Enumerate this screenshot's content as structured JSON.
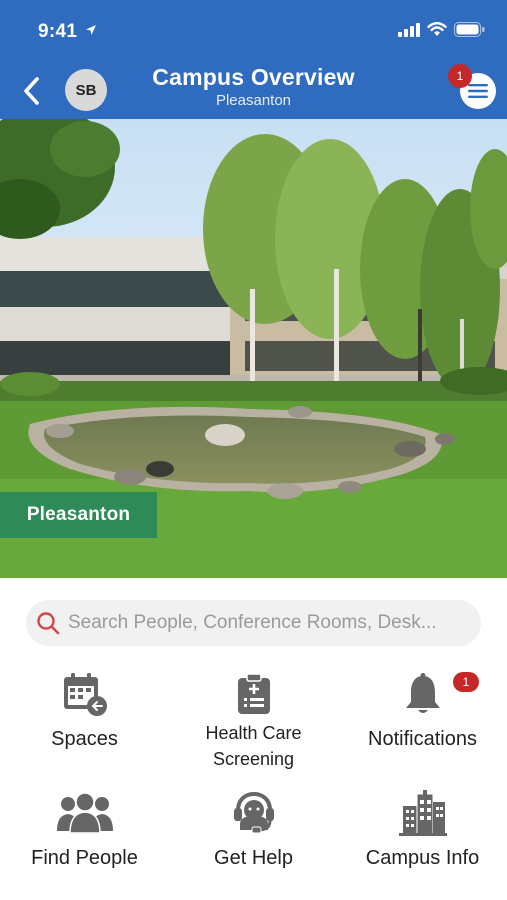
{
  "status_bar": {
    "time": "9:41"
  },
  "header": {
    "avatar_initials": "SB",
    "title": "Campus Overview",
    "subtitle": "Pleasanton",
    "menu_badge": "1"
  },
  "hero": {
    "campus_label": "Pleasanton"
  },
  "search": {
    "placeholder": "Search People, Conference Rooms, Desk..."
  },
  "tiles": [
    {
      "label": "Spaces",
      "icon": "calendar-icon"
    },
    {
      "label_line1": "Health Care",
      "label_line2": "Screening",
      "icon": "clipboard-icon"
    },
    {
      "label": "Notifications",
      "icon": "bell-icon",
      "badge": "1"
    },
    {
      "label": "Find People",
      "icon": "people-icon"
    },
    {
      "label": "Get Help",
      "icon": "headset-icon"
    },
    {
      "label": "Campus Info",
      "icon": "building-icon"
    }
  ],
  "colors": {
    "header_blue": "#2f6bbf",
    "campus_tag_green": "#2e8b57",
    "badge_red": "#c62828",
    "icon_gray": "#666666"
  }
}
